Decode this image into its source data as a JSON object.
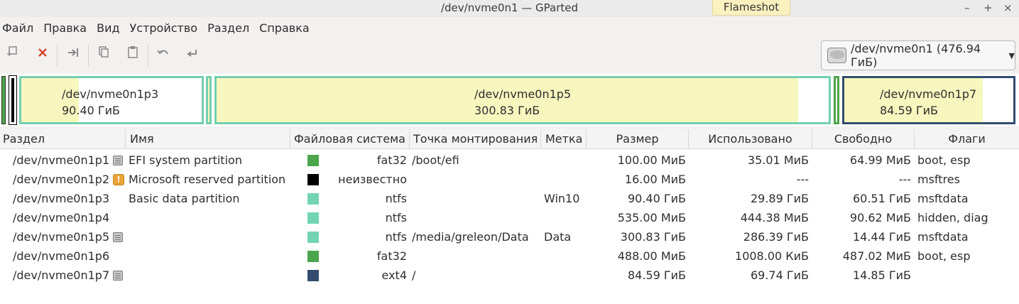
{
  "window": {
    "title": "/dev/nvme0n1 — GParted",
    "overlay_label": "Flameshot",
    "controls": [
      "–",
      "+",
      "×"
    ]
  },
  "menu": [
    "Файл",
    "Правка",
    "Вид",
    "Устройство",
    "Раздел",
    "Справка"
  ],
  "toolbar": {
    "device_selector": "/dev/nvme0n1 (476.94 ГиБ)"
  },
  "map": {
    "segments": [
      {
        "name": "/dev/nvme0n1p3",
        "size": "90.40 ГиБ"
      },
      {
        "name": "/dev/nvme0n1p5",
        "size": "300.83 ГиБ"
      },
      {
        "name": "/dev/nvme0n1p7",
        "size": "84.59 ГиБ"
      }
    ]
  },
  "table": {
    "columns": [
      "Раздел",
      "Имя",
      "Файловая система",
      "Точка монтирования",
      "Метка",
      "Размер",
      "Использовано",
      "Свободно",
      "Флаги"
    ],
    "rows": [
      {
        "partition": "/dev/nvme0n1p1",
        "icon": "info-icon",
        "name": "EFI system partition",
        "fs": "fat32",
        "fs_color": "#4ba54b",
        "mount": "/boot/efi",
        "label": "",
        "size": "100.00 МиБ",
        "used": "35.01 МиБ",
        "free": "64.99 МиБ",
        "flags": "boot, esp"
      },
      {
        "partition": "/dev/nvme0n1p2",
        "icon": "warning-icon",
        "name": "Microsoft reserved partition",
        "fs": "неизвестно",
        "fs_color": "#000000",
        "mount": "",
        "label": "",
        "size": "16.00 МиБ",
        "used": "---",
        "free": "---",
        "flags": "msftres"
      },
      {
        "partition": "/dev/nvme0n1p3",
        "icon": "",
        "name": "Basic data partition",
        "fs": "ntfs",
        "fs_color": "#72d4b4",
        "mount": "",
        "label": "Win10",
        "size": "90.40 ГиБ",
        "used": "29.89 ГиБ",
        "free": "60.51 ГиБ",
        "flags": "msftdata"
      },
      {
        "partition": "/dev/nvme0n1p4",
        "icon": "",
        "name": "",
        "fs": "ntfs",
        "fs_color": "#72d4b4",
        "mount": "",
        "label": "",
        "size": "535.00 МиБ",
        "used": "444.38 МиБ",
        "free": "90.62 МиБ",
        "flags": "hidden, diag"
      },
      {
        "partition": "/dev/nvme0n1p5",
        "icon": "info-icon",
        "name": "",
        "fs": "ntfs",
        "fs_color": "#72d4b4",
        "mount": "/media/greleon/Data",
        "label": "Data",
        "size": "300.83 ГиБ",
        "used": "286.39 ГиБ",
        "free": "14.44 ГиБ",
        "flags": "msftdata"
      },
      {
        "partition": "/dev/nvme0n1p6",
        "icon": "",
        "name": "",
        "fs": "fat32",
        "fs_color": "#4ba54b",
        "mount": "",
        "label": "",
        "size": "488.00 МиБ",
        "used": "1008.00 КиБ",
        "free": "487.02 МиБ",
        "flags": "boot, esp"
      },
      {
        "partition": "/dev/nvme0n1p7",
        "icon": "info-icon",
        "name": "",
        "fs": "ext4",
        "fs_color": "#324d70",
        "mount": "/",
        "label": "",
        "size": "84.59 ГиБ",
        "used": "69.74 ГиБ",
        "free": "14.85 ГиБ",
        "flags": ""
      }
    ]
  }
}
